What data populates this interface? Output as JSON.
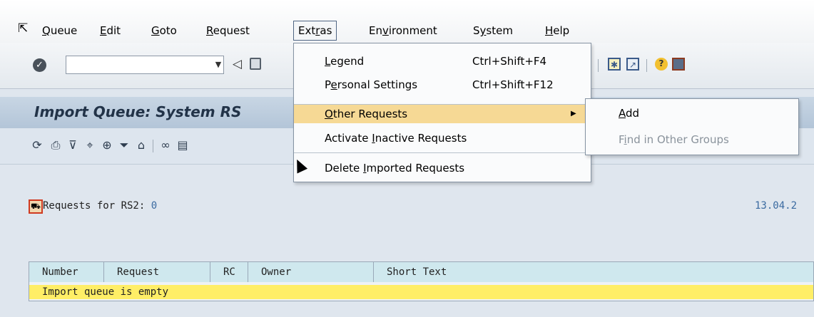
{
  "menubar": {
    "items": [
      {
        "pre": "",
        "u": "Q",
        "post": "ueue"
      },
      {
        "pre": "",
        "u": "E",
        "post": "dit"
      },
      {
        "pre": "",
        "u": "G",
        "post": "oto"
      },
      {
        "pre": "",
        "u": "R",
        "post": "equest"
      },
      {
        "pre": "Ext",
        "u": "r",
        "post": "as"
      },
      {
        "pre": "En",
        "u": "v",
        "post": "ironment"
      },
      {
        "pre": "S",
        "u": "y",
        "post": "stem"
      },
      {
        "pre": "",
        "u": "H",
        "post": "elp"
      }
    ]
  },
  "toolbar": {
    "command_field_value": "",
    "icons": [
      "check-icon",
      "dropdown-icon",
      "back-icon",
      "save-icon",
      "layout-icon",
      "shortcut-icon",
      "help-icon",
      "customize-icon"
    ]
  },
  "title": "Import Queue: System RS",
  "app_toolbar": {
    "icons": [
      "refresh-icon",
      "print-icon",
      "filter-icon",
      "zoom-icon",
      "find-icon",
      "funnel-icon",
      "hierarchy-icon",
      "link-icon",
      "table-icon"
    ]
  },
  "content": {
    "requests_label": "Requests for RS2:",
    "requests_count": "0",
    "date": "13.04.2",
    "table": {
      "columns": [
        "Number",
        "Request",
        "RC",
        "Owner",
        "Short Text"
      ],
      "empty_message": "Import queue is empty"
    }
  },
  "extras_menu": {
    "items": [
      {
        "pre": "",
        "u": "L",
        "post": "egend",
        "shortcut": "Ctrl+Shift+F4"
      },
      {
        "pre": "P",
        "u": "e",
        "post": "rsonal Settings",
        "shortcut": "Ctrl+Shift+F12"
      },
      {
        "pre": "",
        "u": "O",
        "post": "ther Requests",
        "shortcut": ""
      },
      {
        "pre": "Activate ",
        "u": "I",
        "post": "nactive Requests",
        "shortcut": ""
      },
      {
        "pre": "Delete ",
        "u": "I",
        "post": "mported Requests",
        "shortcut": ""
      }
    ],
    "highlight_color": "#f6d995"
  },
  "other_requests_submenu": {
    "items": [
      {
        "pre": "",
        "u": "A",
        "post": "dd",
        "enabled": true
      },
      {
        "pre": "F",
        "u": "i",
        "post": "nd in Other Groups",
        "enabled": false
      }
    ]
  }
}
